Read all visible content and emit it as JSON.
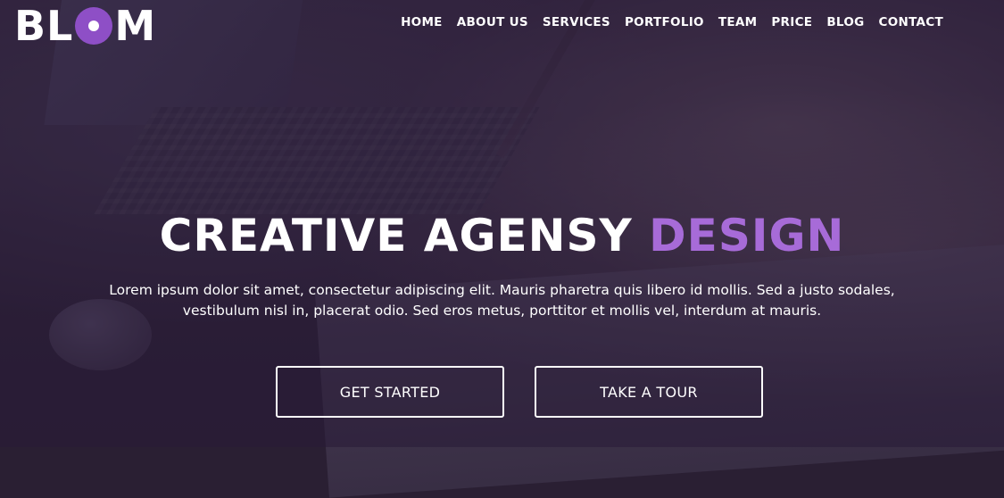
{
  "logo": {
    "before": "BL",
    "after": "M"
  },
  "nav": [
    {
      "label": "HOME"
    },
    {
      "label": "ABOUT US"
    },
    {
      "label": "SERVICES"
    },
    {
      "label": "PORTFOLIO"
    },
    {
      "label": "TEAM"
    },
    {
      "label": "PRICE"
    },
    {
      "label": "BLOG"
    },
    {
      "label": "CONTACT"
    }
  ],
  "hero": {
    "title_main": "CREATIVE AGENSY",
    "title_accent": "DESIGN",
    "description": "Lorem ipsum dolor sit amet, consectetur adipiscing elit. Mauris pharetra quis libero id mollis. Sed a justo sodales, vestibulum nisl in, placerat odio. Sed eros metus, porttitor et mollis vel, interdum at mauris.",
    "buttons": {
      "primary": "GET STARTED",
      "secondary": "TAKE A TOUR"
    }
  },
  "colors": {
    "accent": "#a76bd8",
    "logo_accent": "#8e4fc6",
    "overlay": "#2a1f33"
  }
}
